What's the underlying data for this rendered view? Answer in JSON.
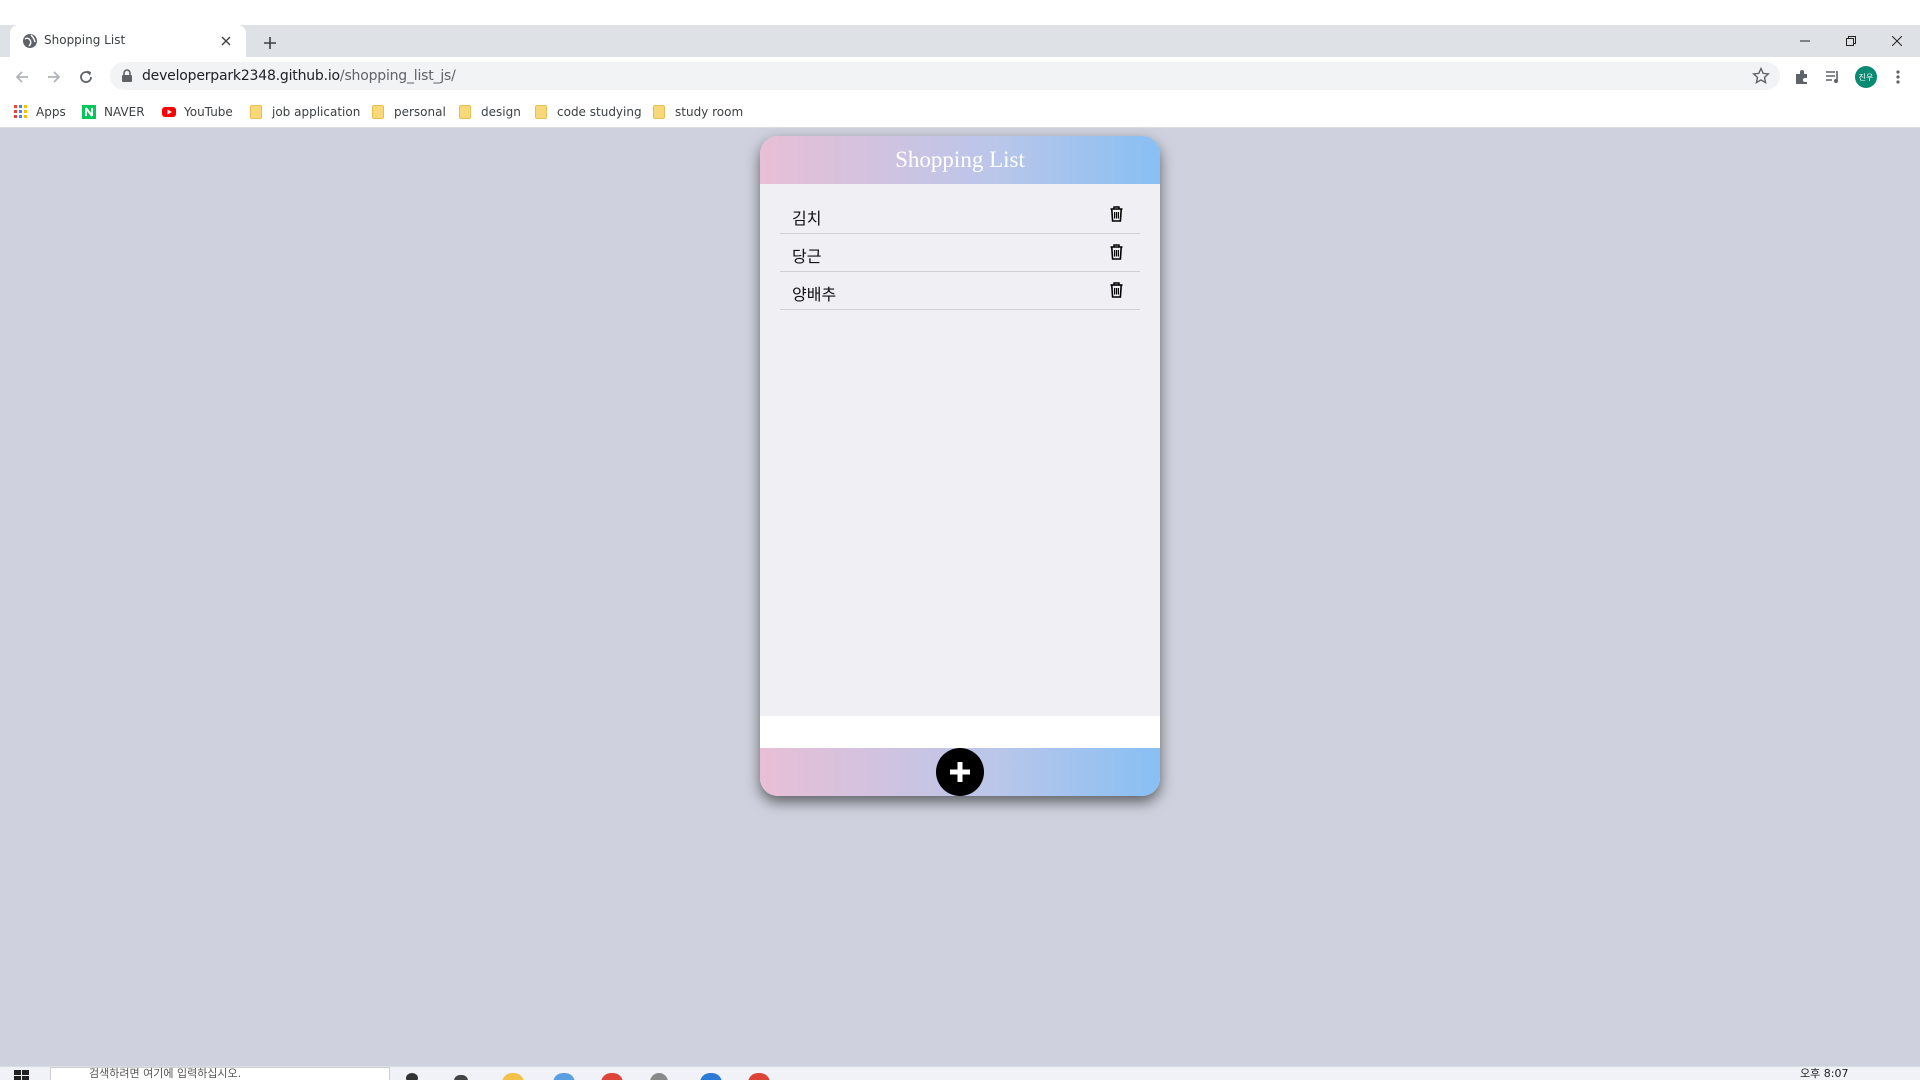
{
  "browser": {
    "tab": {
      "title": "Shopping List",
      "close_icon": "close-icon",
      "favicon": "globe-icon"
    },
    "new_tab_icon": "plus-icon",
    "window_controls": [
      "minimize-icon",
      "restore-icon",
      "close-icon"
    ],
    "address": {
      "host": "developerpark2348.github.io",
      "path": "/shopping_list_js/"
    },
    "profile_initials": "진우",
    "bookmarks": [
      {
        "label": "Apps",
        "icon": "apps-grid-icon"
      },
      {
        "label": "NAVER",
        "icon": "naver-icon"
      },
      {
        "label": "YouTube",
        "icon": "youtube-icon"
      },
      {
        "label": "job application",
        "icon": "folder-icon"
      },
      {
        "label": "personal",
        "icon": "folder-icon"
      },
      {
        "label": "design",
        "icon": "folder-icon"
      },
      {
        "label": "code studying",
        "icon": "folder-icon"
      },
      {
        "label": "study room",
        "icon": "folder-icon"
      }
    ]
  },
  "app": {
    "title": "Shopping List",
    "items": [
      {
        "name": "김치"
      },
      {
        "name": "당근"
      },
      {
        "name": "양배추"
      }
    ],
    "input_value": "",
    "add_icon": "plus-icon",
    "delete_icon": "trash-icon",
    "colors": {
      "gradient_start": "#e8bfd6",
      "gradient_end": "#87bff4",
      "page_bg": "#cfd2de",
      "card_bg": "#f0eff4"
    }
  },
  "taskbar": {
    "search_placeholder": "검색하려면 여기에 입력하십시오.",
    "clock": "오후 8:07"
  }
}
